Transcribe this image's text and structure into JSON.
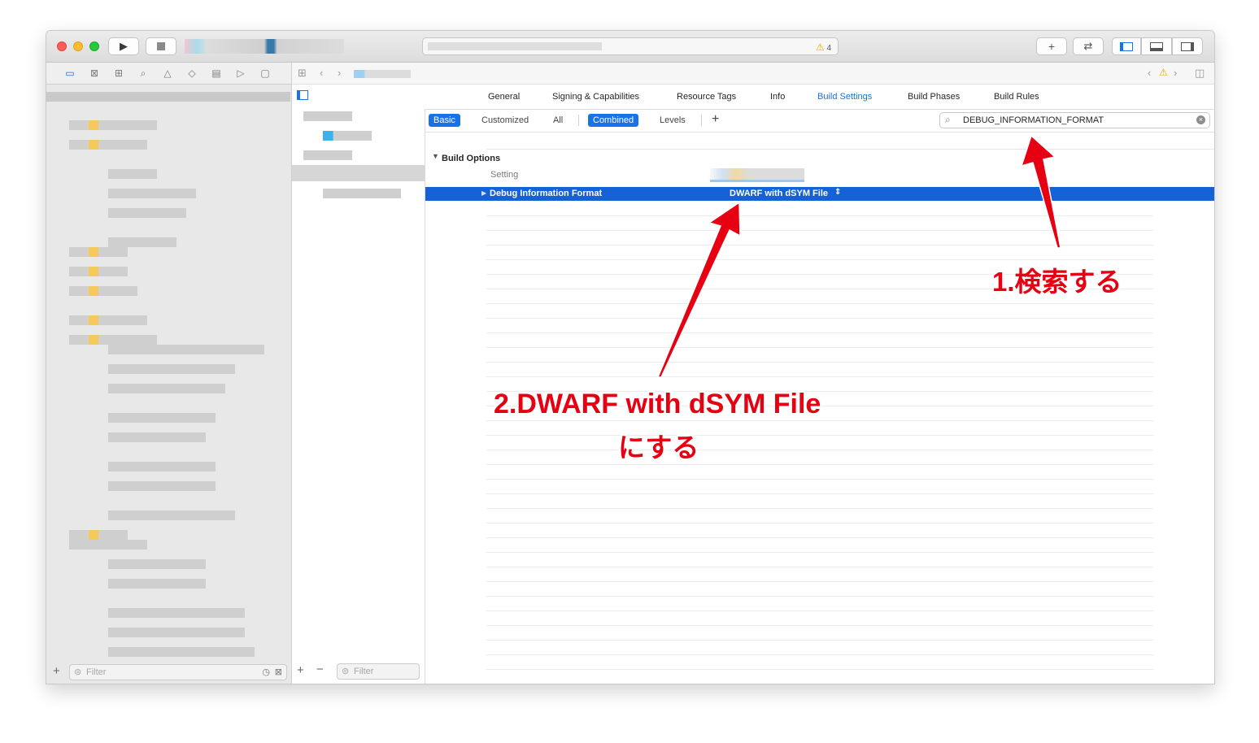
{
  "toolbar": {
    "warning_count": "4",
    "add_label": "+"
  },
  "navigator": {
    "filter_placeholder": "Filter"
  },
  "targets": {
    "filter_placeholder": "Filter"
  },
  "editor_tabs": [
    "General",
    "Signing & Capabilities",
    "Resource Tags",
    "Info",
    "Build Settings",
    "Build Phases",
    "Build Rules"
  ],
  "active_tab": "Build Settings",
  "filter_bar": {
    "basic": "Basic",
    "customized": "Customized",
    "all": "All",
    "combined": "Combined",
    "levels": "Levels",
    "add": "+"
  },
  "search": {
    "value": "DEBUG_INFORMATION_FORMAT"
  },
  "build_options": {
    "section_title": "Build Options",
    "setting_header": "Setting",
    "row_name": "Debug Information Format",
    "row_value": "DWARF with dSYM File"
  },
  "annotations": {
    "step1": "1.検索する",
    "step2_line1": "2.DWARF with dSYM File",
    "step2_line2": "にする"
  },
  "colors": {
    "accent": "#1a72e8",
    "selection": "#1562d8",
    "annotation": "#e60012",
    "folder": "#f5c95a"
  }
}
